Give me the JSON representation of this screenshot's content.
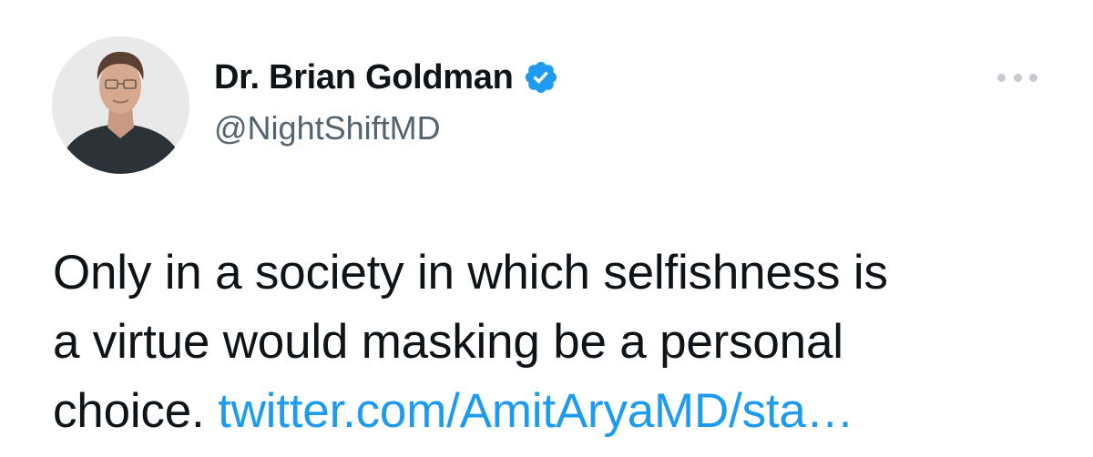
{
  "author": {
    "display_name": "Dr. Brian Goldman",
    "handle": "@NightShiftMD",
    "verified": true,
    "avatar_icon": "profile-photo"
  },
  "menu": {
    "icon": "more-options-icon"
  },
  "tweet": {
    "line1": "Only in a society in which selfishness is",
    "line2": "a virtue would masking be a personal",
    "line3_text": "choice. ",
    "link_text": "twitter.com/AmitAryaMD/sta…"
  },
  "colors": {
    "link": "#1d9bf0",
    "verified_badge": "#1d9bf0",
    "handle": "#536471",
    "text": "#0f1419"
  }
}
